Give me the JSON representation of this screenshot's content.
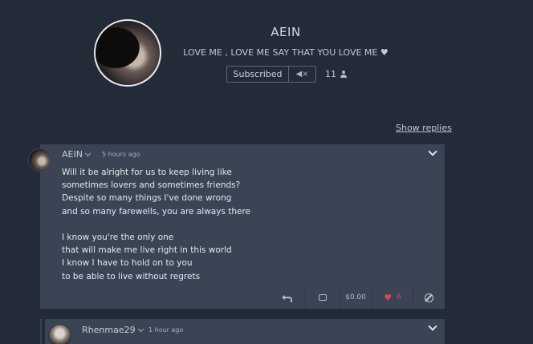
{
  "profile": {
    "name": "AEIN",
    "bio": "LOVE ME , LOVE ME SAY THAT YOU LOVE ME",
    "bio_icon": "heart-icon",
    "subscribed_label": "Subscribed",
    "mute_icon": "mute-icon",
    "mute_glyph": "◀×",
    "subscriber_count": "11",
    "count_icon": "person-icon"
  },
  "thread": {
    "show_replies_label": "Show replies"
  },
  "comment": {
    "author": "AEIN",
    "time": "5 hours ago",
    "lines": [
      "Will it be alright for us to keep living like",
      "sometimes lovers and sometimes friends?",
      "Despite so many things I've done wrong",
      "and so many farewells, you are always there",
      "",
      "I know you're the only one",
      "that will make me live right in this world",
      "I know I have to hold on to you",
      "to be able to live without regrets"
    ],
    "actions": {
      "reply_icon": "reply-icon",
      "repost_icon": "repost-icon",
      "tip_label": "$0.00",
      "like_icon": "heart-icon",
      "like_count": "6",
      "block_icon": "block-icon"
    }
  },
  "reply": {
    "author": "Rhenmae29",
    "time": "1 hour ago"
  },
  "colors": {
    "background": "#232b38",
    "card": "#3a4454",
    "like": "#e0434b"
  }
}
